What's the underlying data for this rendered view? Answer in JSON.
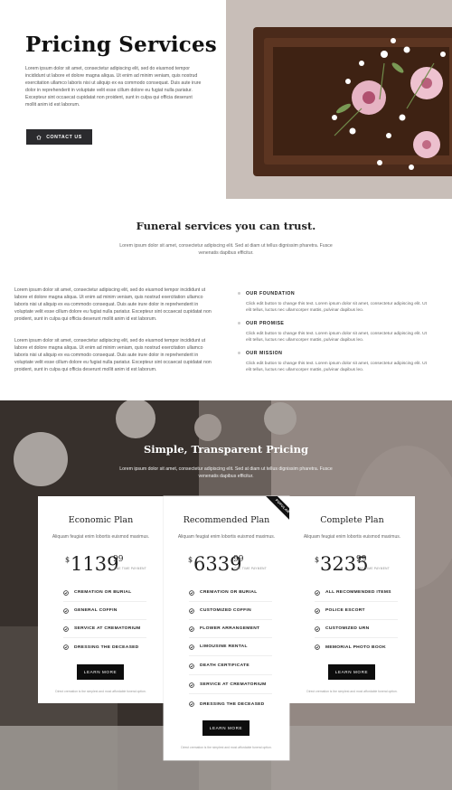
{
  "hero": {
    "title": "Pricing Services",
    "body": "Lorem ipsum dolor sit amet, consectetur adipiscing elit, sed do eiusmod tempor incididunt ut labore et dolore magna aliqua. Ut enim ad minim veniam, quis nostrud exercitation ullamco laboris nisi ut aliquip ex ea commodo consequat. Duis aute irure dolor in reprehenderit in voluptate velit esse cillum dolore eu fugiat nulla pariatur. Excepteur sint occaecat cupidatat non proident, sunt in culpa qui officia deserunt mollit anim id est laborum.",
    "contact_label": "CONTACT US",
    "contact_icon": "home-icon"
  },
  "trust": {
    "title": "Funeral services you can trust.",
    "subtitle": "Lorem ipsum dolor sit amet, consectetur adipiscing elit. Sed at diam ut tellus dignissim pharetra. Fusce venenatis dapibus efficitur.",
    "paragraphs": [
      "Lorem ipsum dolor sit amet, consectetur adipiscing elit, sed do eiusmod tempor incididunt ut labore et dolore magna aliqua. Ut enim ad minim veniam, quis nostrud exercitation ullamco laboris nisi ut aliquip ex ea commodo consequat. Duis aute irure dolor in reprehenderit in voluptate velit esse cillum dolore eu fugiat nulla pariatur. Excepteur sint occaecat cupidatat non proident, sunt in culpa qui officia deserunt mollit anim id est laborum.",
      "Lorem ipsum dolor sit amet, consectetur adipiscing elit, sed do eiusmod tempor incididunt ut labore et dolore magna aliqua. Ut enim ad minim veniam, quis nostrud exercitation ullamco laboris nisi ut aliquip ex ea commodo consequat. Duis aute irure dolor in reprehenderit in voluptate velit esse cillum dolore eu fugiat nulla pariatur. Excepteur sint occaecat cupidatat non proident, sunt in culpa qui officia deserunt mollit anim id est laborum."
    ],
    "features": [
      {
        "title": "OUR FOUNDATION",
        "text": "Click edit button to change this text. Lorem ipsum dolor sit amet, consectetur adipiscing elit. Ut elit tellus, luctus nec ullamcorper mattis, pulvinar dapibus leo."
      },
      {
        "title": "OUR PROMISE",
        "text": "Click edit button to change this text. Lorem ipsum dolor sit amet, consectetur adipiscing elit. Ut elit tellus, luctus nec ullamcorper mattis, pulvinar dapibus leo."
      },
      {
        "title": "OUR MISSION",
        "text": "Click edit button to change this text. Lorem ipsum dolor sit amet, consectetur adipiscing elit. Ut elit tellus, luctus nec ullamcorper mattis, pulvinar dapibus leo."
      }
    ]
  },
  "pricing": {
    "title": "Simple, Transparent Pricing",
    "subtitle": "Lorem ipsum dolor sit amet, consectetur adipiscing elit. Sed at diam ut tellus dignissim pharetra. Fusce venenatis dapibus efficitur.",
    "plans": [
      {
        "name": "Economic Plan",
        "desc": "Aliquam feugiat enim lobortis euismod maximus.",
        "currency": "$",
        "amount": "1139",
        "cents": "99",
        "note": "ONE TIME PAYMENT",
        "items": [
          "CREMATION OR BURIAL",
          "GENERAL COFFIN",
          "SERVICE AT CREMATORIUM",
          "DRESSING THE DECEASED"
        ],
        "button": "LEARN MORE",
        "foot": "Direct cremation is the simplest and most affordable funeral option."
      },
      {
        "name": "Recommended Plan",
        "desc": "Aliquam feugiat enim lobortis euismod maximus.",
        "currency": "$",
        "amount": "6339",
        "cents": "99",
        "note": "ONE TIME PAYMENT",
        "badge": "POPULAR",
        "items": [
          "CREMATION OR BURIAL",
          "CUSTOMIZED COFFIN",
          "FLOWER ARRANGEMENT",
          "LIMOUSINE RENTAL",
          "DEATH CERTIFICATE",
          "SERVICE AT CREMATORIUM",
          "DRESSING THE DECEASED"
        ],
        "button": "LEARN MORE",
        "foot": "Direct cremation is the simplest and most affordable funeral option."
      },
      {
        "name": "Complete Plan",
        "desc": "Aliquam feugiat enim lobortis euismod maximus.",
        "currency": "$",
        "amount": "3235",
        "cents": "99",
        "note": "ONE TIME PAYMENT",
        "items": [
          "ALL RECOMMENDED ITEMS",
          "POLICE ESCORT",
          "CUSTOMIZED URN",
          "MEMORIAL PHOTO BOOK"
        ],
        "button": "LEARN MORE",
        "foot": "Direct cremation is the simplest and most affordable funeral option."
      }
    ]
  },
  "colors": {
    "dark_button": "#2b2b2e",
    "black": "#0d0d0d",
    "accent_pink": "#e7b9c9"
  }
}
